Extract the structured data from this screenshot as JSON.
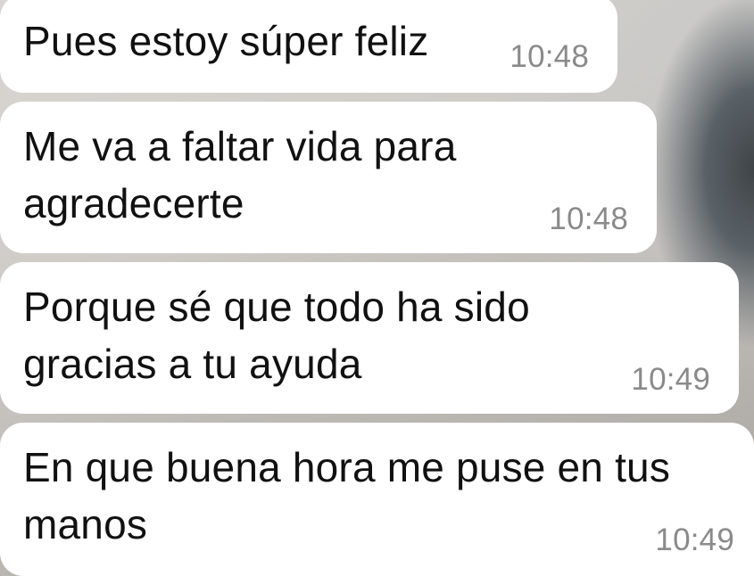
{
  "messages": [
    {
      "text": "Pues estoy súper feliz",
      "time": "10:48"
    },
    {
      "text": "Me va a faltar vida para\nagradecerte",
      "time": "10:48"
    },
    {
      "text": "Porque sé que todo ha sido\ngracias a tu ayuda",
      "time": "10:49"
    },
    {
      "text": "En que buena hora me puse en tus\nmanos",
      "time": "10:49"
    }
  ],
  "colors": {
    "bubble_background": "#ffffff",
    "message_text": "#111111",
    "timestamp_text": "#8a8a8a"
  }
}
